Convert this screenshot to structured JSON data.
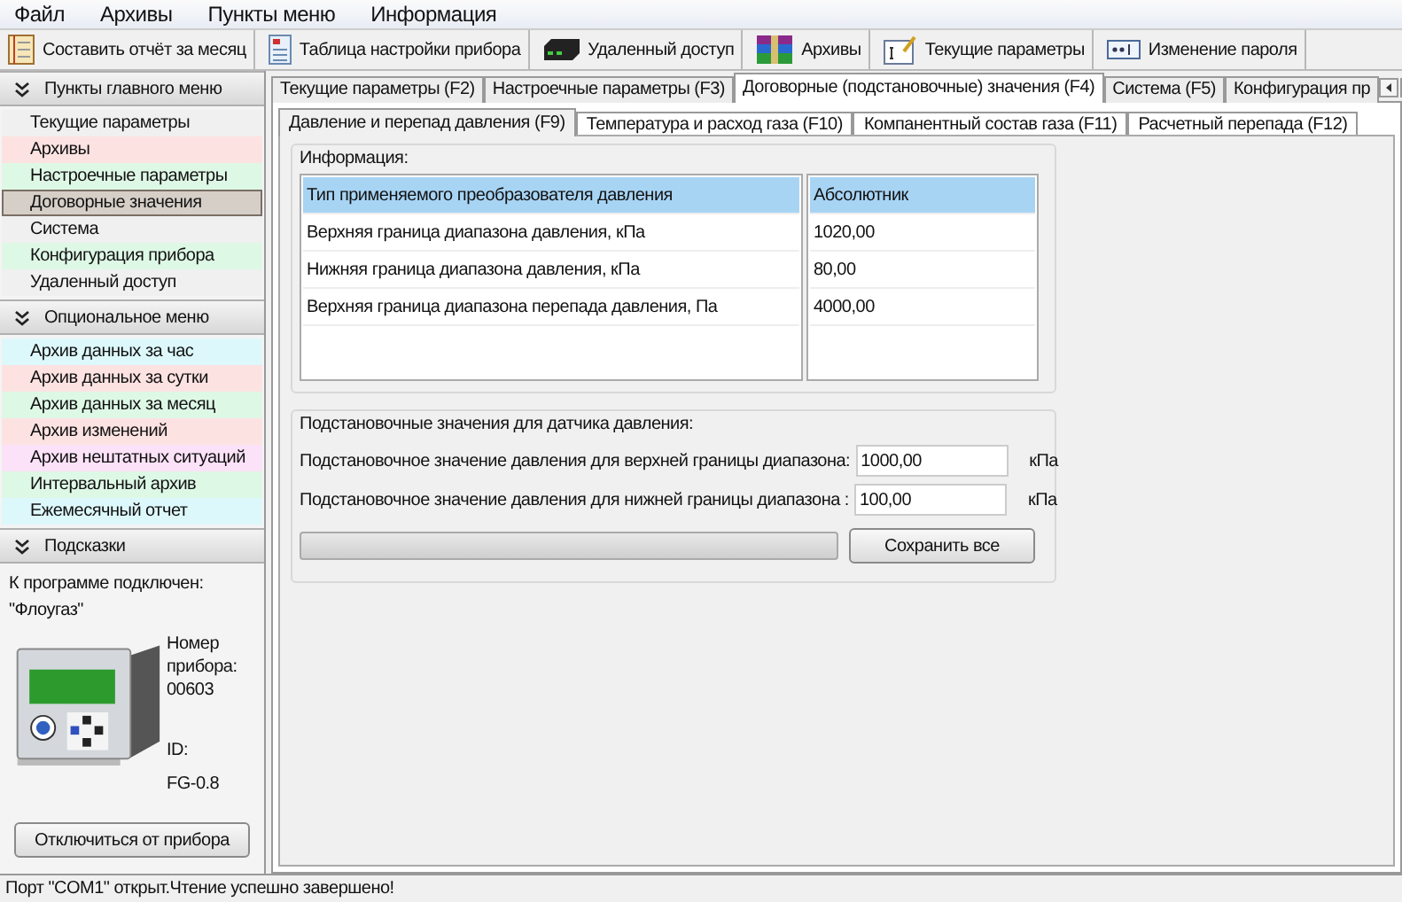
{
  "menu_bar": [
    "Файл",
    "Архивы",
    "Пункты меню",
    "Информация"
  ],
  "toolbar": [
    {
      "label": "Составить отчёт за месяц",
      "kind": "notebook"
    },
    {
      "label": "Таблица настройки прибора",
      "kind": "document"
    },
    {
      "label": "Удаленный доступ",
      "kind": "modem"
    },
    {
      "label": "Архивы",
      "kind": "archive"
    },
    {
      "label": "Текущие параметры",
      "kind": "edit"
    },
    {
      "label": "Изменение пароля",
      "kind": "password"
    }
  ],
  "sidebar": {
    "sections": [
      {
        "title": "Пункты главного меню",
        "items": [
          {
            "label": "Текущие параметры",
            "color": "#f0f0f0",
            "selected": false
          },
          {
            "label": "Архивы",
            "color": "#fde2e2",
            "selected": false
          },
          {
            "label": "Настроечные параметры",
            "color": "#def8e6",
            "selected": false
          },
          {
            "label": "Договорные значения",
            "color": "#d6cfc8",
            "selected": true
          },
          {
            "label": "Система",
            "color": "#f0f0f0",
            "selected": false
          },
          {
            "label": "Конфигурация прибора",
            "color": "#def8e6",
            "selected": false
          },
          {
            "label": "Удаленный доступ",
            "color": "#f0f0f0",
            "selected": false
          }
        ]
      },
      {
        "title": "Опциональное меню",
        "items": [
          {
            "label": "Архив данных за час",
            "color": "#ddf8fb",
            "selected": false
          },
          {
            "label": "Архив данных за сутки",
            "color": "#fde2e2",
            "selected": false
          },
          {
            "label": "Архив данных за месяц",
            "color": "#def8e6",
            "selected": false
          },
          {
            "label": "Архив изменений",
            "color": "#fde2e2",
            "selected": false
          },
          {
            "label": "Архив нештатных ситуаций",
            "color": "#fce2f8",
            "selected": false
          },
          {
            "label": "Интервальный архив",
            "color": "#def8e6",
            "selected": false
          },
          {
            "label": "Ежемесячный отчет",
            "color": "#ddf8fb",
            "selected": false
          }
        ]
      }
    ],
    "hints": {
      "title": "Подсказки",
      "connected_text": "К программе подключен:",
      "device_name": "\"Флоугаз\"",
      "number_label": "Номер прибора:",
      "number": "00603",
      "id_label": "ID:",
      "id": "FG-0.8",
      "disconnect_button": "Отключиться от прибора"
    }
  },
  "main_tabs": [
    {
      "label": "Текущие параметры (F2)",
      "selected": false
    },
    {
      "label": "Настроечные параметры (F3)",
      "selected": false
    },
    {
      "label": "Договорные (подстановочные) значения (F4)",
      "selected": true
    },
    {
      "label": "Система (F5)",
      "selected": false
    },
    {
      "label": "Конфигурация пр",
      "selected": false
    }
  ],
  "sub_tabs": [
    {
      "label": "Давление и перепад давления (F9)",
      "selected": true
    },
    {
      "label": "Температура и расход газа (F10)",
      "selected": false
    },
    {
      "label": "Компанентный состав газа (F11)",
      "selected": false
    },
    {
      "label": "Расчетный перепада (F12)",
      "selected": false
    }
  ],
  "info": {
    "title": "Информация:",
    "rows": [
      {
        "name": "Тип применяемого преобразователя давления",
        "value": "Абсолютник",
        "selected": true
      },
      {
        "name": "Верхняя граница диапазона давления, кПа",
        "value": "1020,00",
        "selected": false
      },
      {
        "name": "Нижняя граница диапазона давления, кПа",
        "value": "80,00",
        "selected": false
      },
      {
        "name": "Верхняя граница диапазона перепада давления, Па",
        "value": "4000,00",
        "selected": false
      }
    ]
  },
  "substitutes": {
    "title": "Подстановочные значения для датчика давления:",
    "fields": [
      {
        "label": "Подстановочное значение давления для верхней границы диапазона:",
        "value": "1000,00",
        "unit": "кПа"
      },
      {
        "label": "Подстановочное значение давления для нижней границы диапазона :",
        "value": "100,00",
        "unit": "кПа"
      }
    ],
    "progress": {
      "level": 0
    },
    "save_button": "Сохранить все"
  },
  "status_bar": "Порт \"COM1\" открыт.Чтение успешно завершено!"
}
